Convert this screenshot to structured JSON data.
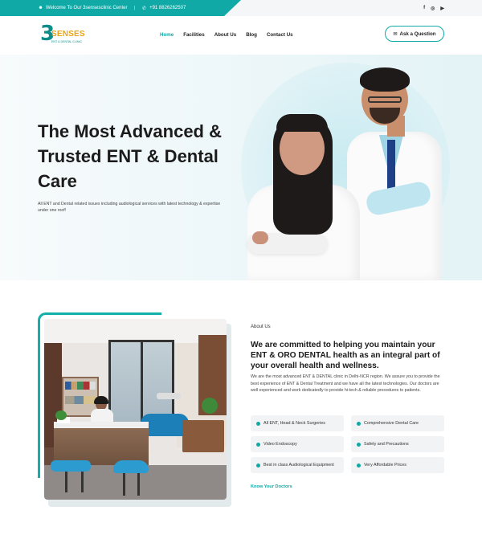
{
  "topbar": {
    "welcome_text": "Welcome To Our 3sensesclinic Center",
    "separator": "|",
    "phone": "+91 8826262507",
    "socials": [
      "facebook-icon",
      "instagram-icon",
      "youtube-icon"
    ],
    "social_glyphs": [
      "f",
      "◎",
      "▶"
    ]
  },
  "logo": {
    "number": "3",
    "word": "SENSES",
    "tagline": "ENT & DENTAL CLINIC"
  },
  "nav": {
    "items": [
      "Home",
      "Facilities",
      "About Us",
      "Blog",
      "Contact Us"
    ],
    "active": "Home"
  },
  "ask_button": {
    "label": "Ask a Question"
  },
  "hero": {
    "title": "The Most Advanced & Trusted ENT & Dental Care",
    "description": "All ENT and Dental related issues including audiological services with latest technology & expertise under one roof!"
  },
  "about": {
    "kicker": "About Us",
    "title": "We are committed to helping you maintain your ENT & ORO DENTAL health as an integral part of your overall health and wellness.",
    "body": "We are the most advanced ENT  & DENTAL clinic in Delhi-NCR  region. We assure you to provide the best experience of ENT & Dental Treatment and we have all the latest technologies. Our doctors are well experienced and work dedicatedly to provide hi-tech & reliable procedures to patients.",
    "features": [
      "All ENT, Head & Neck Surgeries",
      "Comprehensive Dental Care",
      "Video Endoscopy",
      "Safety and Precautions",
      "Best in class Audiological Equipment",
      "Very Affordable Prices"
    ],
    "link": "Know Your Doctors"
  },
  "colors": {
    "accent": "#10a9a6",
    "logo_orange": "#e9a31b"
  }
}
